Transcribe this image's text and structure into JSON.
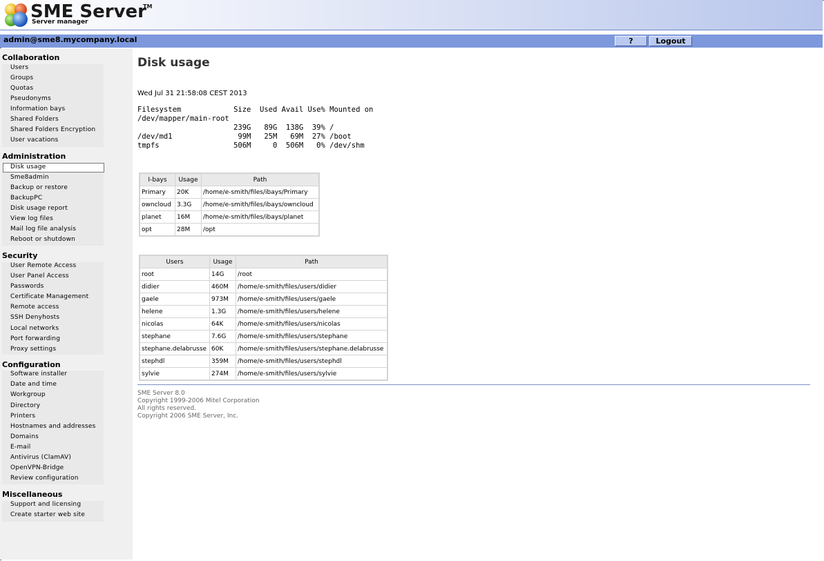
{
  "header": {
    "title": "SME Server",
    "trademark": "TM",
    "subtitle": "Server manager"
  },
  "topbar": {
    "user": "admin@sme8.mycompany.local",
    "help_label": "?",
    "logout_label": "Logout"
  },
  "sidebar": {
    "sections": [
      {
        "title": "Collaboration",
        "items": [
          "Users",
          "Groups",
          "Quotas",
          "Pseudonyms",
          "Information bays",
          "Shared Folders",
          "Shared Folders Encryption",
          "User vacations"
        ]
      },
      {
        "title": "Administration",
        "items": [
          "Disk usage",
          "Sme8admin",
          "Backup or restore",
          "BackupPC",
          "Disk usage report",
          "View log files",
          "Mail log file analysis",
          "Reboot or shutdown"
        ]
      },
      {
        "title": "Security",
        "items": [
          "User Remote Access",
          "User Panel Access",
          "Passwords",
          "Certificate Management",
          "Remote access",
          "SSH Denyhosts",
          "Local networks",
          "Port forwarding",
          "Proxy settings"
        ]
      },
      {
        "title": "Configuration",
        "items": [
          "Software installer",
          "Date and time",
          "Workgroup",
          "Directory",
          "Printers",
          "Hostnames and addresses",
          "Domains",
          "E-mail",
          "Antivirus (ClamAV)",
          "OpenVPN-Bridge",
          "Review configuration"
        ]
      },
      {
        "title": "Miscellaneous",
        "items": [
          "Support and licensing",
          "Create starter web site"
        ]
      }
    ],
    "selected": "Disk usage"
  },
  "main": {
    "title": "Disk usage",
    "date": "Wed Jul 31 21:58:08 CEST 2013",
    "df_output": "Filesystem            Size  Used Avail Use% Mounted on\n/dev/mapper/main-root\n                      239G   89G  138G  39% /\n/dev/md1               99M   25M   69M  27% /boot\ntmpfs                 506M     0  506M   0% /dev/shm",
    "ibays_table": {
      "headers": [
        "I-bays",
        "Usage",
        "Path"
      ],
      "rows": [
        [
          "Primary",
          "20K",
          "/home/e-smith/files/ibays/Primary"
        ],
        [
          "owncloud",
          "3.3G",
          "/home/e-smith/files/ibays/owncloud"
        ],
        [
          "planet",
          "16M",
          "/home/e-smith/files/ibays/planet"
        ],
        [
          "opt",
          "28M",
          "/opt"
        ]
      ]
    },
    "users_table": {
      "headers": [
        "Users",
        "Usage",
        "Path"
      ],
      "rows": [
        [
          "root",
          "14G",
          "/root"
        ],
        [
          "didier",
          "460M",
          "/home/e-smith/files/users/didier"
        ],
        [
          "gaele",
          "973M",
          "/home/e-smith/files/users/gaele"
        ],
        [
          "helene",
          "1.3G",
          "/home/e-smith/files/users/helene"
        ],
        [
          "nicolas",
          "64K",
          "/home/e-smith/files/users/nicolas"
        ],
        [
          "stephane",
          "7.6G",
          "/home/e-smith/files/users/stephane"
        ],
        [
          "stephane.delabrusse",
          "60K",
          "/home/e-smith/files/users/stephane.delabrusse"
        ],
        [
          "stephdl",
          "359M",
          "/home/e-smith/files/users/stephdl"
        ],
        [
          "sylvie",
          "274M",
          "/home/e-smith/files/users/sylvie"
        ]
      ]
    }
  },
  "footer": {
    "lines": [
      "SME Server 8.0",
      "Copyright 1999-2006 Mitel Corporation",
      "All rights reserved.",
      "Copyright 2006 SME Server, Inc."
    ]
  },
  "colors": {
    "topbar": "#7d98dc",
    "sidebar": "#f0f0f0",
    "table_header": "#e9e9e9"
  }
}
